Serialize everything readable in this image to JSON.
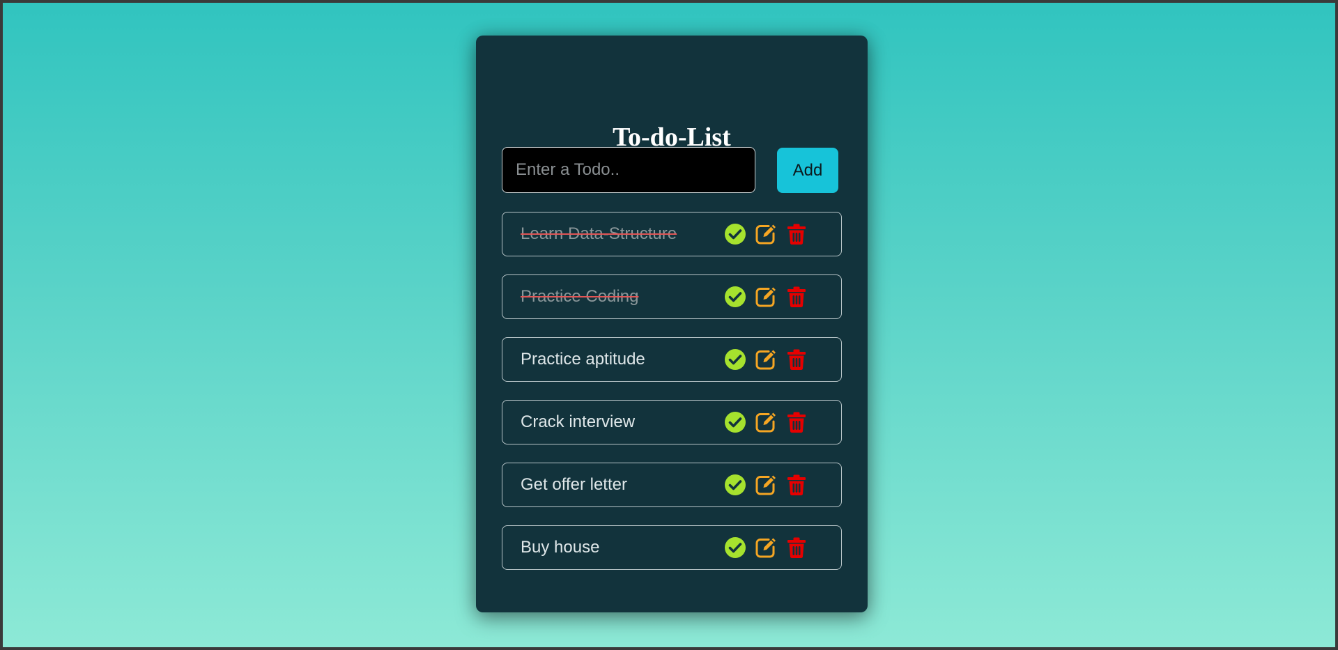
{
  "app": {
    "title": "To-do-List",
    "input": {
      "placeholder": "Enter a Todo..",
      "value": ""
    },
    "add_button_label": "Add",
    "colors": {
      "complete_icon": "#a6e22e",
      "edit_icon": "#f5a623",
      "delete_icon": "#e60000",
      "add_button": "#17c3d9",
      "card_background": "#12333c"
    },
    "icons": {
      "complete": "check-circle-icon",
      "edit": "edit-icon",
      "delete": "trash-icon"
    },
    "todos": [
      {
        "text": "Learn Data-Structure",
        "completed": true
      },
      {
        "text": "Practice Coding",
        "completed": true
      },
      {
        "text": "Practice aptitude",
        "completed": false
      },
      {
        "text": "Crack interview",
        "completed": false
      },
      {
        "text": "Get offer letter",
        "completed": false
      },
      {
        "text": "Buy house",
        "completed": false
      }
    ]
  }
}
